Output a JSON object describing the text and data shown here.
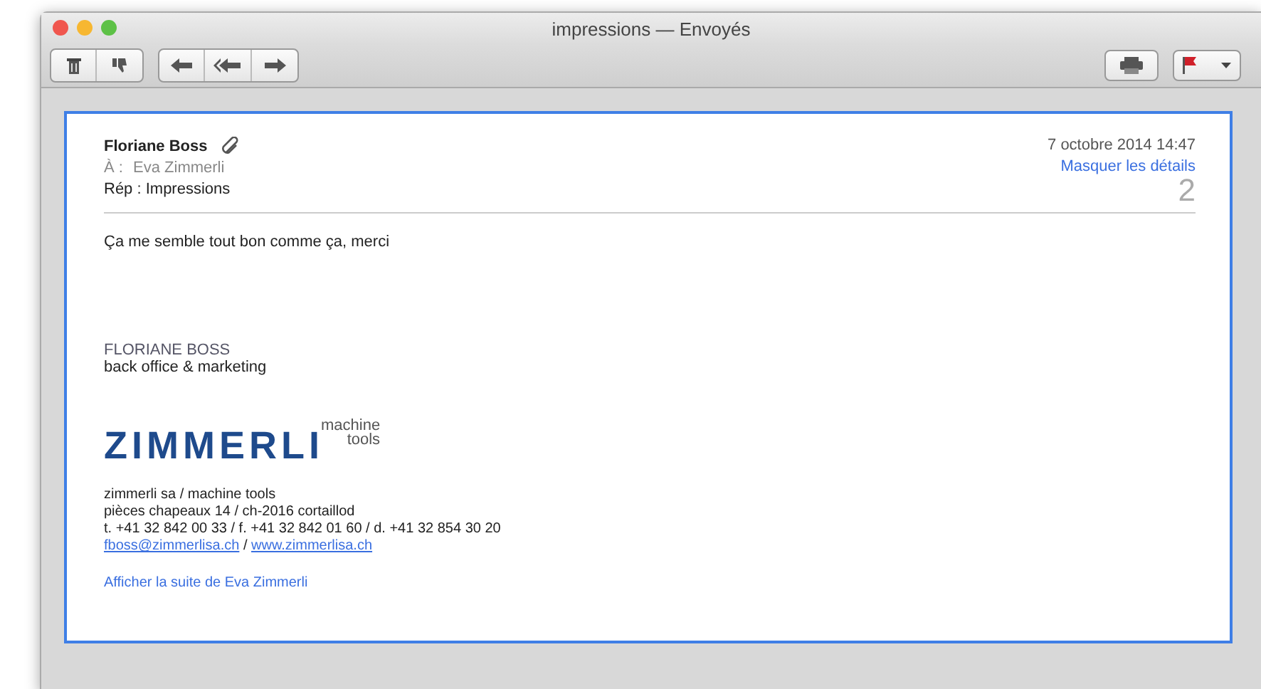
{
  "window": {
    "title": "impressions — Envoyés"
  },
  "toolbar": {
    "groups": [
      {
        "buttons": [
          {
            "kind": "trash"
          },
          {
            "kind": "junk"
          }
        ]
      },
      {
        "buttons": [
          {
            "kind": "reply"
          },
          {
            "kind": "reply-all"
          },
          {
            "kind": "forward"
          }
        ]
      }
    ],
    "right": [
      {
        "kind": "print"
      },
      {
        "kind": "flag"
      }
    ]
  },
  "message": {
    "from": "Floriane Boss",
    "to_label": "À :",
    "to": "Eva Zimmerli",
    "subject": "Rép : Impressions",
    "date": "7 octobre 2014 14:47",
    "details_link": "Masquer les détails",
    "count": "2",
    "body": "Ça me semble tout bon comme ça, merci",
    "signature": {
      "name": "FLORIANE BOSS",
      "role": "back office & marketing",
      "logo": "ZIMMERLI",
      "logo_sub_1": "machine",
      "logo_sub_2": "tools",
      "lines": [
        "zimmerli sa / machine tools",
        "pièces chapeaux 14 / ch-2016 cortaillod",
        "t. +41 32 842 00 33 / f. +41 32 842 01 60 / d. +41 32 854 30 20"
      ],
      "email": "fboss@zimmerlisa.ch",
      "separator": "/",
      "website": "www.zimmerlisa.ch"
    },
    "more_link": "Afficher la suite de Eva Zimmerli"
  }
}
